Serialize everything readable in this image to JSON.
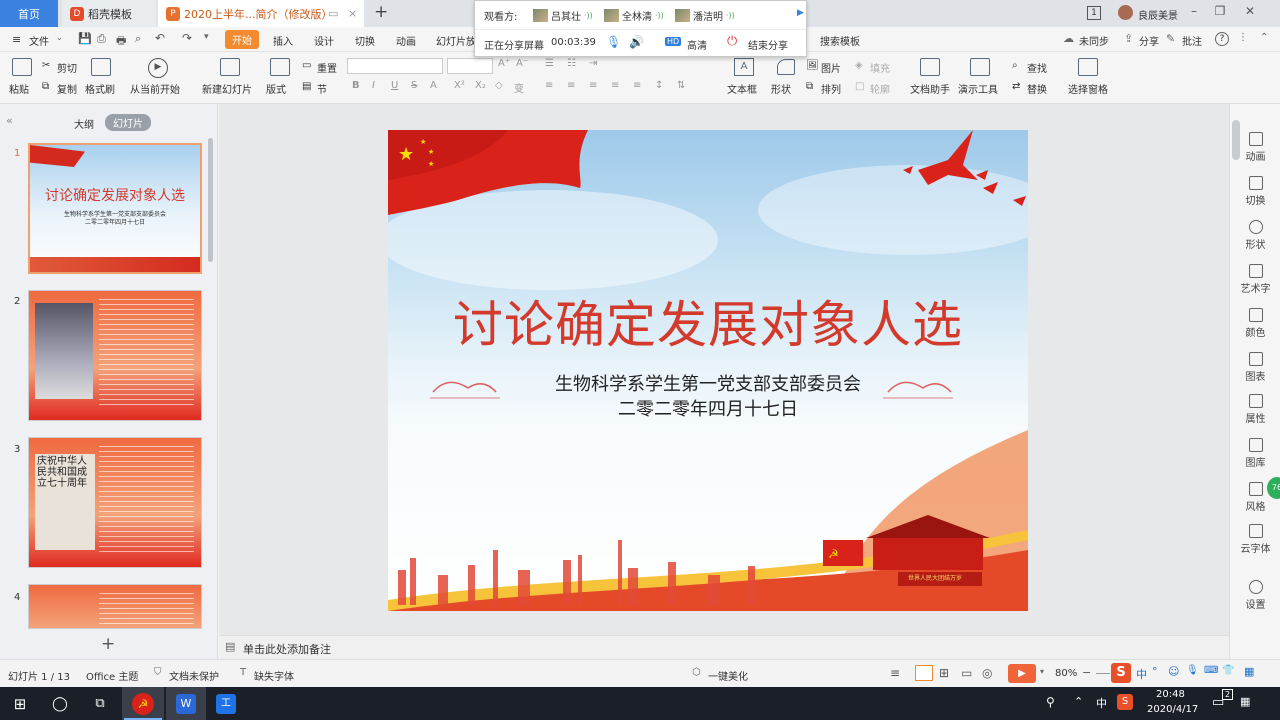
{
  "titlebar": {
    "tabs": [
      {
        "label": "首页"
      },
      {
        "label": "稻壳模板"
      },
      {
        "label": "2020上半年...简介（修改版）"
      }
    ],
    "add_tab": "+",
    "page_badge": "1",
    "user_name": "良辰美景"
  },
  "share": {
    "viewers_label": "观看方:",
    "viewers": [
      "吕其壮",
      "全林清",
      "潘洁明"
    ],
    "status_label": "正在分享屏幕",
    "timer": "00:03:39",
    "hd_badge": "HD",
    "hd_label": "高清",
    "end_label": "结束分享"
  },
  "menu": {
    "file": "文件",
    "items": [
      "开始",
      "插入",
      "设计",
      "切换",
      "动画",
      "幻灯片放"
    ],
    "search": "搜索模板",
    "sync": "未同步",
    "share": "分享",
    "comment": "批注",
    "help": "?"
  },
  "ribbon": {
    "paste": "粘贴",
    "cut": "剪切",
    "copy": "复制",
    "format_painter": "格式刷",
    "from_current": "从当前开始",
    "new_slide": "新建幻灯片",
    "layout": "版式",
    "reset": "重置",
    "section": "节",
    "text_box": "文本框",
    "shape": "形状",
    "picture": "图片",
    "arrange": "排列",
    "fill": "填充",
    "outline": "轮廓",
    "doc_assistant": "文档助手",
    "present_tools": "演示工具",
    "find": "查找",
    "replace": "替换",
    "selection_pane": "选择窗格",
    "font_buttons": [
      "B",
      "I",
      "U",
      "S",
      "A",
      "X²",
      "X₂",
      "A",
      "◇",
      "变"
    ]
  },
  "leftpanel": {
    "tab_outline": "大纲",
    "tab_slides": "幻灯片",
    "slide_numbers": [
      "1",
      "2",
      "3",
      "4"
    ],
    "add_button": "+"
  },
  "slide": {
    "title": "讨论确定发展对象人选",
    "subtitle1": "生物科学系学生第一党支部支部委员会",
    "subtitle2": "二零二零年四月十七日",
    "banner_text": "世界人民大团结万岁"
  },
  "thumbnail_text": {
    "t1_title": "讨论确定发展对象人选",
    "t1_sub1": "生物科学系学生第一党支部支部委员会",
    "t1_sub2": "二零二零年四月十七日",
    "t3_calligraphy": "庆祝中华人民共和国成立七十周年"
  },
  "rightbar": {
    "items": [
      "动画",
      "切换",
      "形状",
      "艺术字",
      "颜色",
      "图表",
      "属性",
      "图库",
      "风格",
      "云字体",
      "设置"
    ],
    "badge": "76"
  },
  "notes": {
    "placeholder": "单击此处添加备注"
  },
  "status": {
    "slide_info": "幻灯片 1 / 13",
    "theme": "Office 主题",
    "protect": "文档未保护",
    "missing_font": "缺失字体",
    "beautify": "一键美化",
    "zoom": "80%",
    "ime_items": [
      "中",
      "°",
      "☺",
      "🎙",
      "⌨",
      "👕",
      "▦"
    ]
  },
  "taskbar": {
    "ime": "中",
    "time": "20:48",
    "date": "2020/4/17",
    "notify_count": "2"
  },
  "colors": {
    "accent_orange": "#f28a30",
    "title_red": "#d33a2c",
    "tab_blue": "#3b82e0",
    "taskbar": "#1b1f27"
  }
}
